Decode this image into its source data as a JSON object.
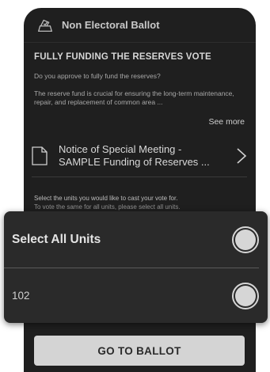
{
  "header": {
    "title": "Non Electoral Ballot",
    "icon": "ballot-box-icon"
  },
  "vote": {
    "title": "FULLY FUNDING THE RESERVES VOTE",
    "question": "Do you approve to fully fund the reserves?",
    "description": "The reserve fund is crucial for ensuring the long-term maintenance, repair, and replacement of common area ...",
    "see_more": "See more"
  },
  "notice": {
    "line1": "Notice of Special Meeting -",
    "line2": "SAMPLE Funding of Reserves ...",
    "icon": "document-icon"
  },
  "instruction": {
    "line1": "Select the units you would like to cast your vote for.",
    "line2": "To vote the same for all units,  please select all units."
  },
  "units": {
    "select_all_label": "Select All Units",
    "items": [
      {
        "label": "102"
      }
    ]
  },
  "footer": {
    "button_label": "GO TO BALLOT"
  },
  "colors": {
    "card_bg": "#1f1f1f",
    "panel_bg": "#2a2a2a",
    "button_bg": "#d4d4d4"
  }
}
